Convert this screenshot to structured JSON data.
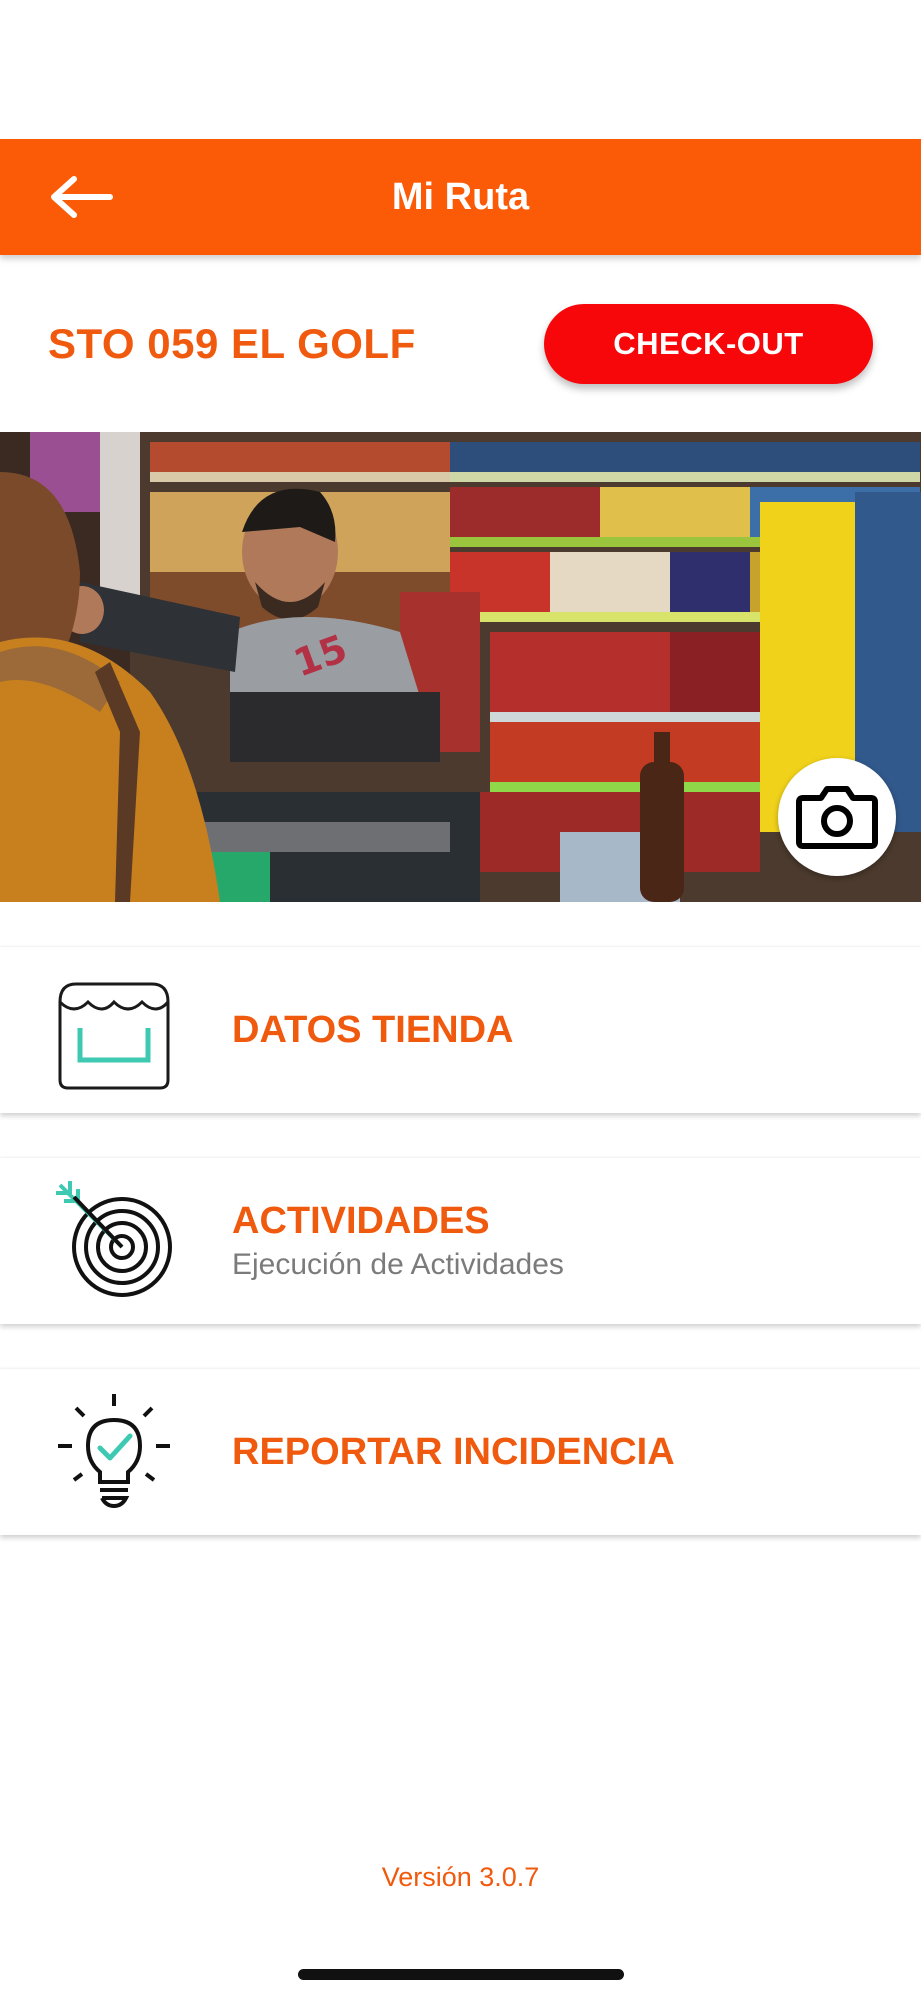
{
  "header": {
    "title": "Mi Ruta",
    "back_icon": "arrow-left-icon",
    "background": "#fb5a06"
  },
  "store": {
    "name": "STO 059 EL GOLF",
    "checkout_label": "CHECK-OUT",
    "checkout_color": "#f8070a",
    "camera_icon": "camera-icon"
  },
  "menu": {
    "items": [
      {
        "label": "DATOS TIENDA",
        "subtitle": "",
        "icon": "store-icon"
      },
      {
        "label": "ACTIVIDADES",
        "subtitle": "Ejecución de Actividades",
        "icon": "target-icon"
      },
      {
        "label": "REPORTAR INCIDENCIA",
        "subtitle": "",
        "icon": "lightbulb-check-icon"
      }
    ]
  },
  "footer": {
    "version": "Versión 3.0.7"
  },
  "colors": {
    "accent": "#f05a0e",
    "icon_teal": "#3ec9b3"
  }
}
